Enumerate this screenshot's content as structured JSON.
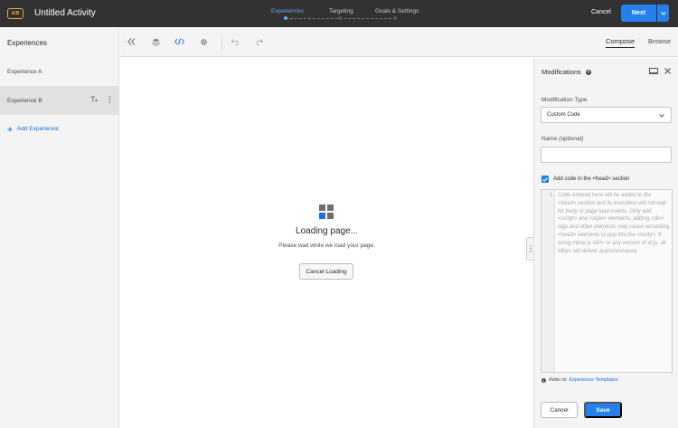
{
  "header": {
    "badge": "A/B",
    "title": "Untitled Activity",
    "steps": [
      {
        "label": "Experiences"
      },
      {
        "label": "Targeting"
      },
      {
        "label": "Goals & Settings"
      }
    ],
    "cancel_label": "Cancel",
    "next_label": "Next"
  },
  "sidebar": {
    "title": "Experiences",
    "items": [
      {
        "label": "Experience A"
      },
      {
        "label": "Experience B"
      }
    ],
    "add_label": "Add Experience"
  },
  "toolbar": {
    "tabs": [
      {
        "label": "Compose"
      },
      {
        "label": "Browse"
      }
    ]
  },
  "canvas": {
    "loading_title": "Loading page...",
    "loading_subtitle": "Please wait while we load your page.",
    "cancel_loading_label": "Cancel Loading"
  },
  "panel": {
    "title": "Modifications",
    "modification_type_label": "Modification Type",
    "modification_type_value": "Custom Code",
    "name_label": "Name",
    "name_optional": "(optional)",
    "checkbox_label": "Add code in the <head> section",
    "code_line_number": "1",
    "code_placeholder": "Code entered here will be added to the <head> section and its execution will not wait for body or page load events. Only add <script> and <style> elements; adding <div> tags and other elements may cause remaining <head> elements to pop into the <body>. If using mbox.js v60+ or any version of at.js, all offers will deliver asynchronously.",
    "refer_prefix": "Refer to",
    "refer_link": "Experience Templates",
    "cancel_label": "Cancel",
    "save_label": "Save"
  }
}
